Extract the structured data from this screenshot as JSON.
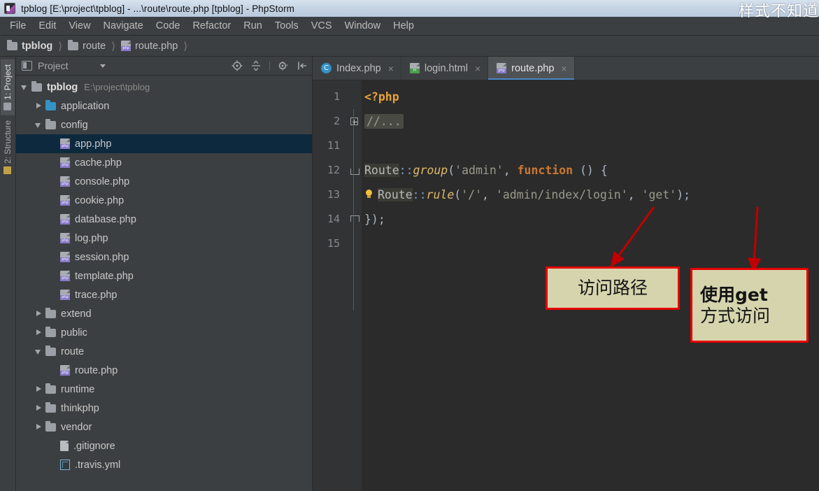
{
  "window": {
    "title": "tpblog [E:\\project\\tpblog] - ...\\route\\route.php [tpblog] - PhpStorm",
    "watermark": "样式不知道"
  },
  "menu": {
    "items": [
      {
        "label": "File"
      },
      {
        "label": "Edit"
      },
      {
        "label": "View"
      },
      {
        "label": "Navigate"
      },
      {
        "label": "Code"
      },
      {
        "label": "Refactor"
      },
      {
        "label": "Run"
      },
      {
        "label": "Tools"
      },
      {
        "label": "VCS"
      },
      {
        "label": "Window"
      },
      {
        "label": "Help"
      }
    ]
  },
  "breadcrumb": {
    "items": [
      {
        "label": "tpblog",
        "icon": "folder-icon"
      },
      {
        "label": "route",
        "icon": "folder-icon"
      },
      {
        "label": "route.php",
        "icon": "php-file-icon"
      }
    ]
  },
  "toolstrip": {
    "tabs": [
      {
        "label": "1: Project",
        "active": true
      },
      {
        "label": "2: Structure",
        "active": false
      }
    ]
  },
  "project_panel": {
    "title": "Project",
    "tools": [
      "locate-target-icon",
      "collapse-all-icon",
      "settings-gear-icon",
      "hide-panel-icon"
    ],
    "tree": [
      {
        "label": "tpblog",
        "sub": "E:\\project\\tpblog",
        "icon": "folder-icon",
        "indent": 0,
        "arrow": "down",
        "bold": true,
        "selected": false
      },
      {
        "label": "application",
        "sub": "",
        "icon": "folder-blue-icon",
        "indent": 1,
        "arrow": "right",
        "bold": false,
        "selected": false
      },
      {
        "label": "config",
        "sub": "",
        "icon": "folder-icon",
        "indent": 1,
        "arrow": "down",
        "bold": false,
        "selected": false
      },
      {
        "label": "app.php",
        "sub": "",
        "icon": "php-file-icon",
        "indent": 2,
        "arrow": "none",
        "bold": false,
        "selected": true
      },
      {
        "label": "cache.php",
        "sub": "",
        "icon": "php-file-icon",
        "indent": 2,
        "arrow": "none",
        "bold": false,
        "selected": false
      },
      {
        "label": "console.php",
        "sub": "",
        "icon": "php-file-icon",
        "indent": 2,
        "arrow": "none",
        "bold": false,
        "selected": false
      },
      {
        "label": "cookie.php",
        "sub": "",
        "icon": "php-file-icon",
        "indent": 2,
        "arrow": "none",
        "bold": false,
        "selected": false
      },
      {
        "label": "database.php",
        "sub": "",
        "icon": "php-file-icon",
        "indent": 2,
        "arrow": "none",
        "bold": false,
        "selected": false
      },
      {
        "label": "log.php",
        "sub": "",
        "icon": "php-file-icon",
        "indent": 2,
        "arrow": "none",
        "bold": false,
        "selected": false
      },
      {
        "label": "session.php",
        "sub": "",
        "icon": "php-file-icon",
        "indent": 2,
        "arrow": "none",
        "bold": false,
        "selected": false
      },
      {
        "label": "template.php",
        "sub": "",
        "icon": "php-file-icon",
        "indent": 2,
        "arrow": "none",
        "bold": false,
        "selected": false
      },
      {
        "label": "trace.php",
        "sub": "",
        "icon": "php-file-icon",
        "indent": 2,
        "arrow": "none",
        "bold": false,
        "selected": false
      },
      {
        "label": "extend",
        "sub": "",
        "icon": "folder-icon",
        "indent": 1,
        "arrow": "right",
        "bold": false,
        "selected": false
      },
      {
        "label": "public",
        "sub": "",
        "icon": "folder-icon",
        "indent": 1,
        "arrow": "right",
        "bold": false,
        "selected": false
      },
      {
        "label": "route",
        "sub": "",
        "icon": "folder-icon",
        "indent": 1,
        "arrow": "down",
        "bold": false,
        "selected": false
      },
      {
        "label": "route.php",
        "sub": "",
        "icon": "php-file-icon",
        "indent": 2,
        "arrow": "none",
        "bold": false,
        "selected": false
      },
      {
        "label": "runtime",
        "sub": "",
        "icon": "folder-icon",
        "indent": 1,
        "arrow": "right",
        "bold": false,
        "selected": false
      },
      {
        "label": "thinkphp",
        "sub": "",
        "icon": "folder-icon",
        "indent": 1,
        "arrow": "right",
        "bold": false,
        "selected": false
      },
      {
        "label": "vendor",
        "sub": "",
        "icon": "folder-icon",
        "indent": 1,
        "arrow": "right",
        "bold": false,
        "selected": false
      },
      {
        "label": ".gitignore",
        "sub": "",
        "icon": "text-file-icon",
        "indent": 2,
        "arrow": "none",
        "bold": false,
        "selected": false
      },
      {
        "label": ".travis.yml",
        "sub": "",
        "icon": "yml-file-icon",
        "indent": 2,
        "arrow": "none",
        "bold": false,
        "selected": false
      }
    ]
  },
  "editor": {
    "tabs": [
      {
        "label": "Index.php",
        "icon": "class-c-icon",
        "active": false,
        "close": "×"
      },
      {
        "label": "login.html",
        "icon": "html-file-icon",
        "active": false,
        "close": "×"
      },
      {
        "label": "route.php",
        "icon": "php-file-icon",
        "active": true,
        "close": "×"
      }
    ],
    "line_numbers": [
      "1",
      "2",
      "11",
      "12",
      "13",
      "14",
      "15"
    ],
    "code": {
      "line1_php_open": "<?php",
      "line2_folded_comment": "//...",
      "line12": {
        "cls": "Route",
        "op": "::",
        "method": "group",
        "open_paren": "(",
        "arg1": "'admin'",
        "comma": ", ",
        "keyword": "function",
        "rest": " () {"
      },
      "line13": {
        "cls": "Route",
        "op": "::",
        "method": "rule",
        "open_paren": "(",
        "arg1": "'/'",
        "comma1": ", ",
        "arg2": "'admin/index/login'",
        "comma2": ", ",
        "arg3": "'get'",
        "end": ");"
      },
      "line14": "});"
    }
  },
  "annotations": [
    {
      "lines": [
        "访问路径"
      ],
      "name": "annotation-access-path"
    },
    {
      "lines": [
        "使用get",
        "方式访问"
      ],
      "name": "annotation-get-method"
    }
  ],
  "colors": {
    "annotation_bg": "#d6d4ad",
    "annotation_border": "#e60000",
    "arrow": "#c00000",
    "accent_tab": "#4a88c7",
    "selection": "#0d293e"
  }
}
